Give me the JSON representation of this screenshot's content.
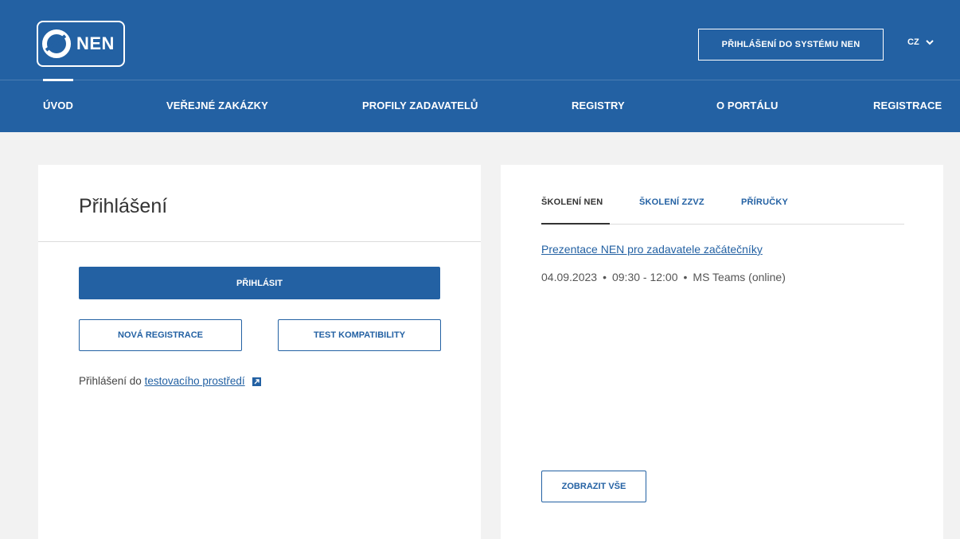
{
  "header": {
    "logo_text": "NEN",
    "login_system_label": "PŘIHLÁŠENÍ DO SYSTÉMU NEN",
    "language": "CZ",
    "brand_color": "#2361a3"
  },
  "nav": {
    "items": [
      {
        "label": "ÚVOD",
        "active": true
      },
      {
        "label": "VEŘEJNÉ ZAKÁZKY",
        "active": false
      },
      {
        "label": "PROFILY ZADAVATELŮ",
        "active": false
      },
      {
        "label": "REGISTRY",
        "active": false
      },
      {
        "label": "O PORTÁLU",
        "active": false
      },
      {
        "label": "REGISTRACE",
        "active": false
      }
    ]
  },
  "login": {
    "title": "Přihlášení",
    "login_button": "PŘIHLÁSIT",
    "new_registration_button": "NOVÁ REGISTRACE",
    "compat_test_button": "TEST KOMPATIBILITY",
    "test_env_prefix": "Přihlášení do ",
    "test_env_link": "testovacího prostředí",
    "test_env_icon": "external-link-icon"
  },
  "trainings": {
    "tabs": [
      {
        "label": "ŠKOLENÍ NEN",
        "active": true
      },
      {
        "label": "ŠKOLENÍ ZZVZ",
        "active": false
      },
      {
        "label": "PŘÍRUČKY",
        "active": false
      }
    ],
    "items": [
      {
        "title": "Prezentace NEN pro zadavatele začátečníky",
        "date": "04.09.2023",
        "time": "09:30  -  12:00",
        "place": "MS Teams (online)"
      }
    ],
    "show_all_button": "ZOBRAZIT VŠE"
  }
}
